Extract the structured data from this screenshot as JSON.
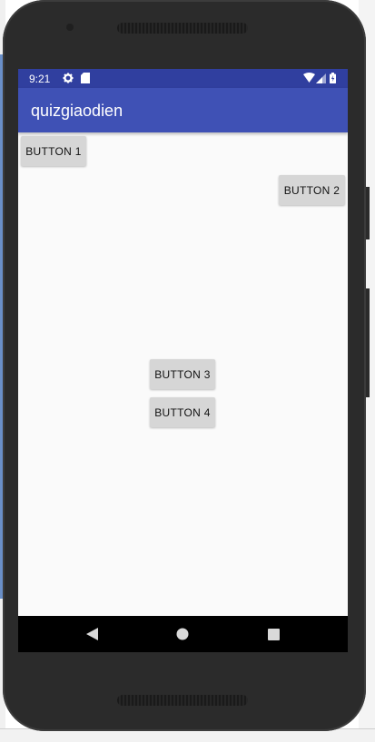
{
  "status_bar": {
    "time": "9:21",
    "icons": [
      "settings-gear-icon",
      "sd-card-icon",
      "wifi-icon",
      "signal-icon",
      "battery-icon"
    ]
  },
  "app_bar": {
    "title": "quizgiaodien",
    "color": "#3f51b5",
    "status_color": "#303f9f"
  },
  "buttons": {
    "b1": "BUTTON 1",
    "b2": "BUTTON 2",
    "b3": "BUTTON 3",
    "b4": "BUTTON 4"
  },
  "nav_bar": {
    "icons": [
      "back-icon",
      "home-icon",
      "recents-icon"
    ]
  }
}
